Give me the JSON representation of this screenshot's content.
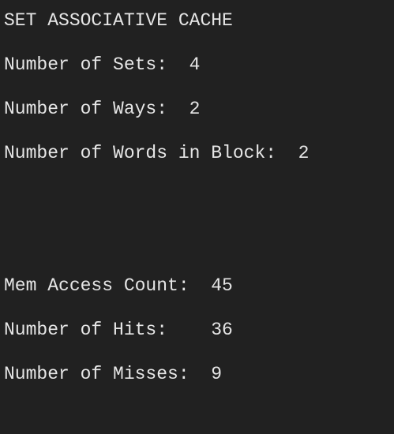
{
  "title": "SET ASSOCIATIVE CACHE",
  "config": {
    "sets_label": "Number of Sets:  ",
    "sets_value": "4",
    "ways_label": "Number of Ways:  ",
    "ways_value": "2",
    "words_label": "Number of Words in Block:  ",
    "words_value": "2"
  },
  "stats": {
    "access_label": "Mem Access Count:  ",
    "access_value": "45",
    "hits_label": "Number of Hits:    ",
    "hits_value": "36",
    "misses_label": "Number of Misses:  ",
    "misses_value": "9"
  }
}
